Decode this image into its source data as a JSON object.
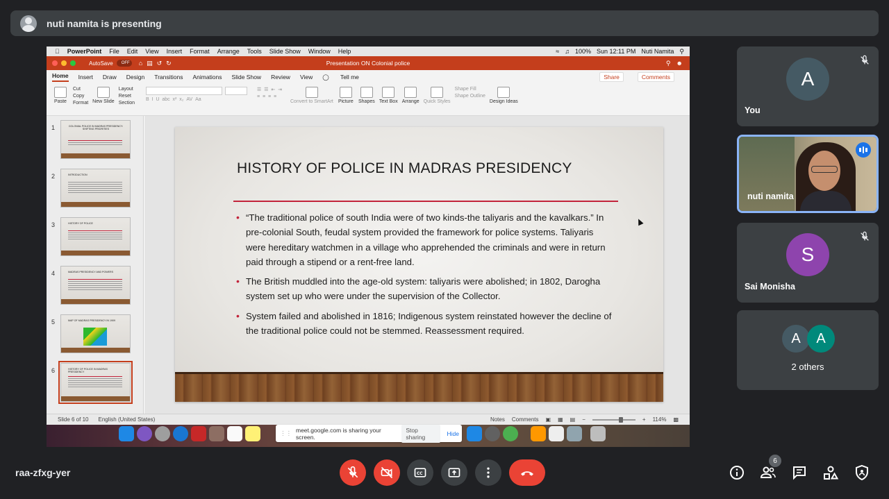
{
  "banner": {
    "text": "nuti namita is presenting"
  },
  "mac_menu": {
    "app": "PowerPoint",
    "items": [
      "File",
      "Edit",
      "View",
      "Insert",
      "Format",
      "Arrange",
      "Tools",
      "Slide Show",
      "Window",
      "Help"
    ],
    "battery": "100%",
    "clock": "Sun 12:11 PM",
    "user": "Nuti Namita"
  },
  "titlebar": {
    "autosave": "AutoSave",
    "toggle": "OFF",
    "doc_title": "Presentation ON Colonial police"
  },
  "ribbon_tabs": {
    "tabs": [
      "Home",
      "Insert",
      "Draw",
      "Design",
      "Transitions",
      "Animations",
      "Slide Show",
      "Review",
      "View"
    ],
    "tell_me": "Tell me",
    "share": "Share",
    "comments": "Comments"
  },
  "ribbon": {
    "paste": "Paste",
    "cut": "Cut",
    "copy": "Copy",
    "format": "Format",
    "new_slide": "New Slide",
    "layout": "Layout",
    "reset": "Reset",
    "section": "Section",
    "convert": "Convert to SmartArt",
    "picture": "Picture",
    "shapes": "Shapes",
    "text_box": "Text Box",
    "arrange": "Arrange",
    "quick_styles": "Quick Styles",
    "shape_fill": "Shape Fill",
    "shape_outline": "Shape Outline",
    "design_ideas": "Design Ideas"
  },
  "thumbnails": [
    {
      "num": "1",
      "title": "COLONIAL POLICE IN MADRAS PRESIDENCY: SHIFTING PRIORITIES"
    },
    {
      "num": "2",
      "title": "INTRODUCTION"
    },
    {
      "num": "3",
      "title": "HISTORY OF POLICE"
    },
    {
      "num": "4",
      "title": "MADRAS PRESIDENCY AND POWERS"
    },
    {
      "num": "5",
      "title": "MAP OF MADRAS PRESIDENCY IN 1909"
    },
    {
      "num": "6",
      "title": "HISTORY OF POLICE IN MADRAS PRESIDENCY"
    }
  ],
  "slide": {
    "title": "HISTORY OF POLICE IN MADRAS PRESIDENCY",
    "bullets": [
      "“The traditional police of south India were of two kinds-the taliyaris and the kavalkars.” In pre-colonial South, feudal system provided the framework for police systems. Taliyaris were hereditary watchmen in a village who apprehended the criminals and were in return paid through a stipend or a rent-free land.",
      "The British muddled into the age-old system: taliyaris were abolished; in 1802, Darogha system set up who were under the supervision of the Collector.",
      "System failed and abolished in 1816; Indigenous system reinstated however the decline of the traditional police could not be stemmed. Reassessment required."
    ]
  },
  "statusbar": {
    "slide_of": "Slide 6 of 10",
    "language": "English (United States)",
    "notes": "Notes",
    "comments": "Comments",
    "zoom": "114%"
  },
  "share_notice": {
    "text": "meet.google.com is sharing your screen.",
    "stop": "Stop sharing",
    "hide": "Hide"
  },
  "participants": [
    {
      "name": "You",
      "initial": "A",
      "color": "#455a64",
      "muted": true
    },
    {
      "name": "nuti namita",
      "speaking": true
    },
    {
      "name": "Sai Monisha",
      "initial": "S",
      "color": "#8e44ad",
      "muted": true
    },
    {
      "name": "2 others",
      "initials": [
        "A",
        "A"
      ],
      "colors": [
        "#455a64",
        "#00897b"
      ]
    }
  ],
  "bottom": {
    "meeting_code": "raa-zfxg-yer",
    "people_count": "6"
  },
  "colors": {
    "accent_red": "#ea4335",
    "ppt_orange": "#c43e1c",
    "slide_rule": "#c2233a"
  }
}
